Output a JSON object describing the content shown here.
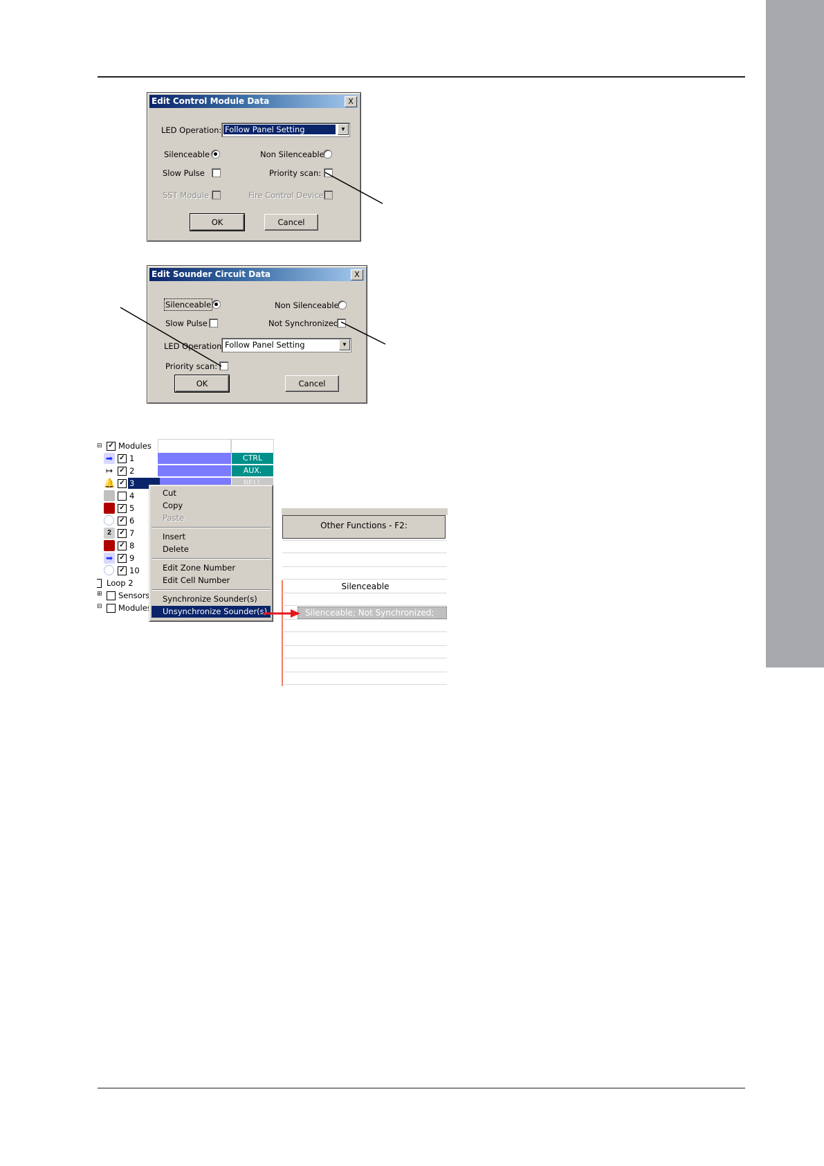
{
  "dialog1": {
    "title": "Edit Control Module Data",
    "close": "X",
    "led_label": "LED Operation:",
    "led_value": "Follow Panel Setting",
    "silenceable": "Silenceable",
    "non_silenceable": "Non Silenceable",
    "slow_pulse": "Slow Pulse",
    "priority_scan": "Priority scan:",
    "sst_module": "SST Module",
    "fire_control": "Fire Control Device",
    "ok": "OK",
    "cancel": "Cancel"
  },
  "dialog2": {
    "title": "Edit Sounder Circuit Data",
    "close": "X",
    "silenceable": "Silenceable",
    "non_silenceable": "Non Silenceable",
    "slow_pulse": "Slow Pulse",
    "not_synchronized": "Not Synchronized",
    "led_label": "LED Operation:",
    "led_value": "Follow Panel Setting",
    "priority_scan": "Priority scan:",
    "ok": "OK",
    "cancel": "Cancel"
  },
  "tree": {
    "modules": "Modules",
    "rows": [
      "1",
      "2",
      "3",
      "4",
      "5",
      "6",
      "7",
      "8",
      "9",
      "10"
    ],
    "loop2": "Loop 2",
    "sensors": "Sensors",
    "modules2": "Modules",
    "type_ctrl": "CTRL",
    "type_aux": "AUX.",
    "type_bell": "BELL"
  },
  "context_menu": {
    "cut": "Cut",
    "copy": "Copy",
    "paste": "Paste",
    "insert": "Insert",
    "delete": "Delete",
    "edit_zone": "Edit Zone Number",
    "edit_cell": "Edit Cell Number",
    "synchronize": "Synchronize Sounder(s)",
    "unsynchronize": "Unsynchronize Sounder(s)"
  },
  "grid": {
    "header": "Other Functions - F2:",
    "row_silenceable": "Silenceable",
    "row_selected": "Silenceable; Not Synchronized;"
  },
  "colors": {
    "title_dark": "#0a246a",
    "dialog_face": "#d4d0c8",
    "side_tab": "#a6a8ab",
    "teal": "#00908a",
    "periwinkle": "#7b7bff",
    "arrow_red": "#e8141c"
  }
}
